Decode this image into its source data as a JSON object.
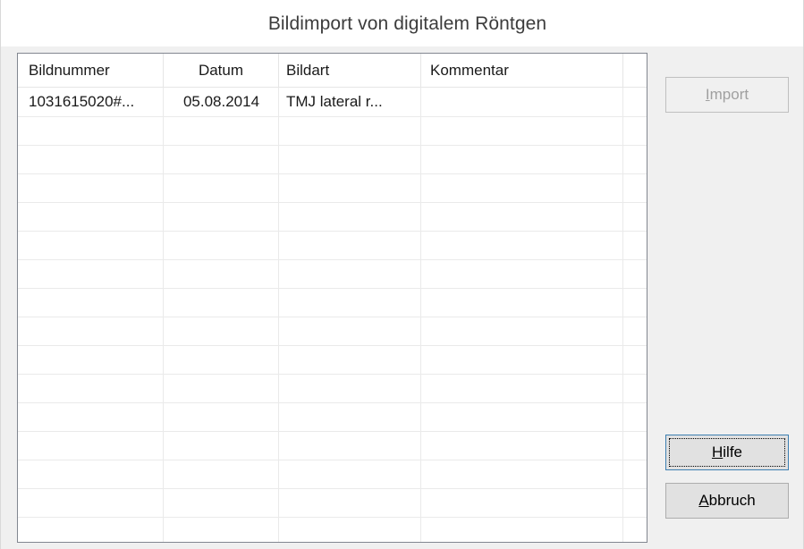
{
  "window": {
    "title": "Bildimport von digitalem Röntgen"
  },
  "table": {
    "columns": [
      "Bildnummer",
      "Datum",
      "Bildart",
      "Kommentar"
    ],
    "rows": [
      [
        "1031615020#...",
        "05.08.2014",
        "TMJ lateral r...",
        ""
      ]
    ]
  },
  "buttons": {
    "import": {
      "mnemonic": "I",
      "rest": "mport",
      "enabled": false
    },
    "hilfe": {
      "mnemonic": "H",
      "rest": "ilfe",
      "default": true
    },
    "abbruch": {
      "mnemonic": "A",
      "rest": "bbruch"
    }
  }
}
